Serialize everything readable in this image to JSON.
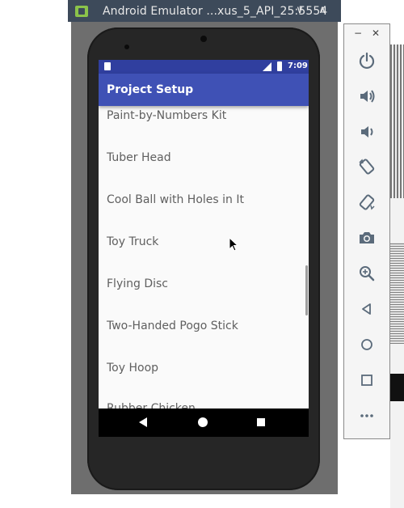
{
  "window": {
    "title": "Android Emulator ...xus_5_API_25:5554"
  },
  "statusbar": {
    "time": "7:09"
  },
  "app": {
    "title": "Project Setup",
    "items": [
      "Paint-by-Numbers Kit",
      "Tuber Head",
      "Cool Ball with Holes in It",
      "Toy Truck",
      "Flying Disc",
      "Two-Handed Pogo Stick",
      "Toy Hoop",
      "Rubber Chicken"
    ]
  },
  "toolbar": {
    "items": [
      "power-icon",
      "volume-up-icon",
      "volume-down-icon",
      "rotate-left-icon",
      "rotate-right-icon",
      "camera-icon",
      "zoom-icon",
      "back-icon",
      "home-icon",
      "overview-icon",
      "more-icon"
    ]
  },
  "colors": {
    "primary": "#3f51b5",
    "primary_dark": "#303f9f",
    "title_bar": "#3d4a5a"
  }
}
